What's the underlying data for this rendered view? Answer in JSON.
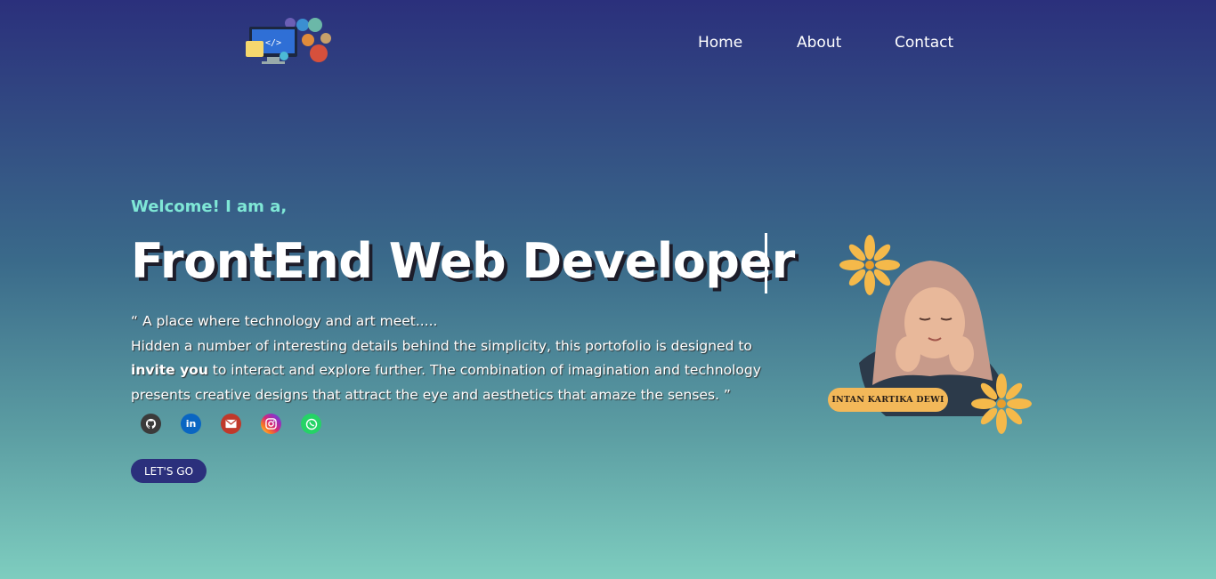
{
  "nav": {
    "home": "Home",
    "about": "About",
    "contact": "Contact"
  },
  "hero": {
    "welcome": "Welcome! I am a,",
    "headline": "FrontEnd Web Developer",
    "quote_line1": "“ A place where technology and art meet.....",
    "quote_part1": "Hidden a number of interesting details behind the simplicity, this portofolio is designed to ",
    "quote_bold": "invite you",
    "quote_part2": " to interact and explore further. The combination of imagination and technology presents creative designs that attract the eye and aesthetics that amaze the senses. ”",
    "cta": "LET'S GO"
  },
  "socials": [
    {
      "name": "github-icon",
      "color": "#3b3b3b"
    },
    {
      "name": "linkedin-icon",
      "color": "#0a66c2",
      "glyph": "in"
    },
    {
      "name": "email-icon",
      "color": "#c0392b"
    },
    {
      "name": "instagram-icon",
      "color": "#d62976"
    },
    {
      "name": "whatsapp-icon",
      "color": "#25d366"
    }
  ],
  "profile": {
    "name": "INTAN KARTIKA DEWI"
  },
  "colors": {
    "accent_text": "#7fe7d6",
    "button": "#2b307c",
    "badge": "#f3b859",
    "flower": "#f5b94a"
  }
}
